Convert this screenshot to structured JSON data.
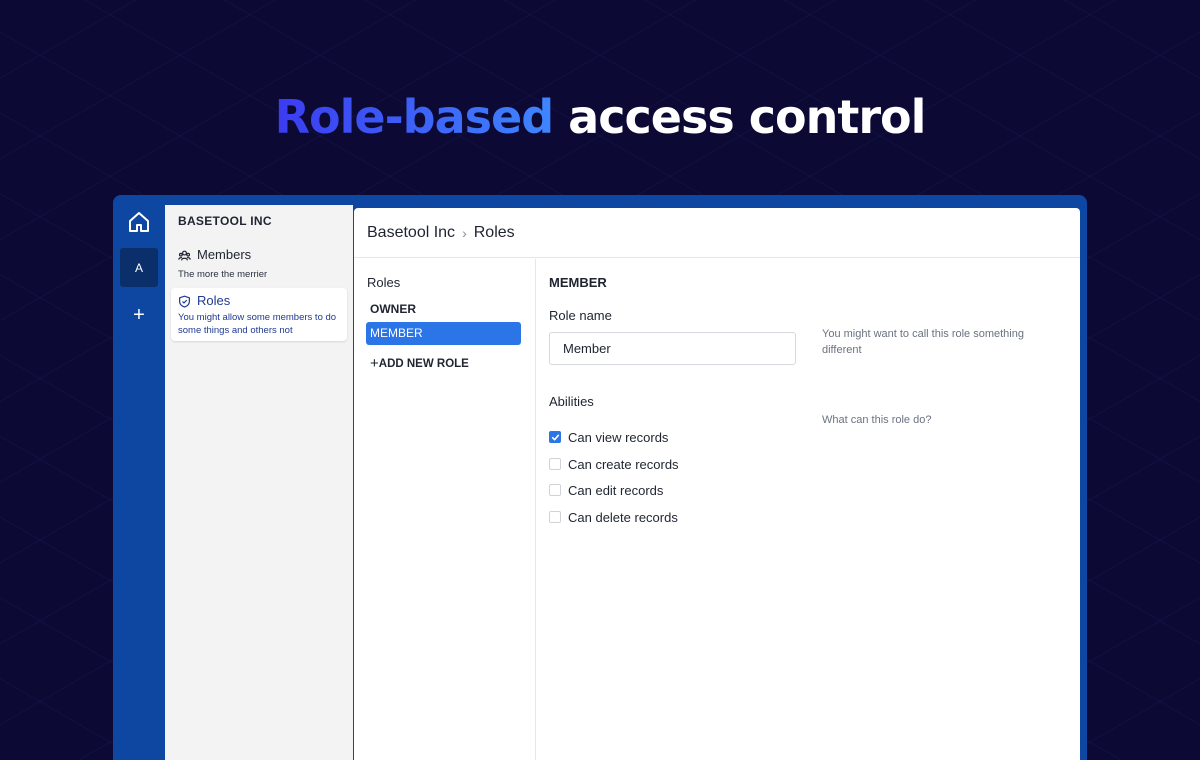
{
  "headline": {
    "accent": "Role-based",
    "rest": "access control"
  },
  "rail": {
    "avatar_letter": "A",
    "add_label": "+"
  },
  "nav": {
    "org_name": "BASETOOL INC",
    "items": [
      {
        "label": "Members",
        "description": "The more the merrier"
      },
      {
        "label": "Roles",
        "description": "You might allow some members to do some things and others not"
      }
    ]
  },
  "breadcrumb": {
    "org": "Basetool Inc",
    "separator": "›",
    "page": "Roles"
  },
  "roles": {
    "title": "Roles",
    "items": [
      "OWNER",
      "MEMBER"
    ],
    "selected": "MEMBER",
    "add_label": "ADD NEW ROLE",
    "add_icon": "+"
  },
  "detail": {
    "title": "MEMBER",
    "role_name_label": "Role name",
    "role_name_value": "Member",
    "role_name_hint": "You might want to call this role something different",
    "abilities_label": "Abilities",
    "abilities_hint": "What can this role do?",
    "abilities": [
      {
        "label": "Can view records",
        "checked": true
      },
      {
        "label": "Can create records",
        "checked": false
      },
      {
        "label": "Can edit records",
        "checked": false
      },
      {
        "label": "Can delete records",
        "checked": false
      }
    ]
  },
  "colors": {
    "accent": "#2b75e6",
    "rail": "#0d47a1",
    "background": "#0c0a35"
  },
  "icons": {
    "home": "home-icon",
    "members": "users-icon",
    "roles": "shield-icon",
    "check": "check-icon"
  }
}
